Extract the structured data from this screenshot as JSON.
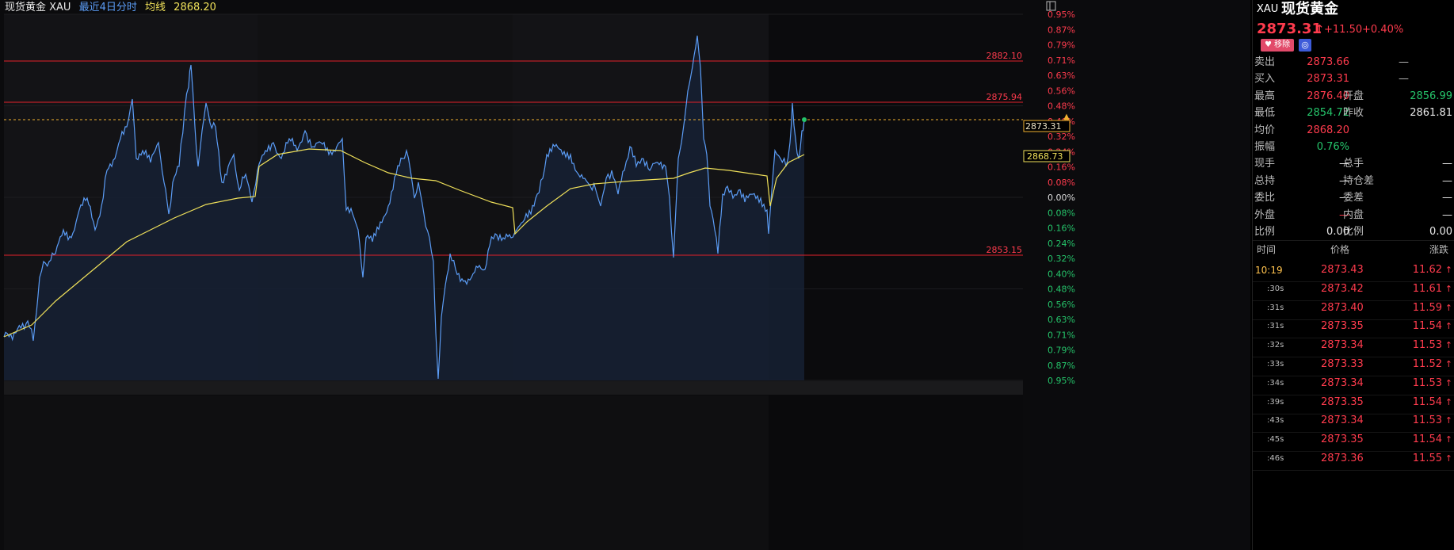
{
  "header": {
    "name": "现货黄金 XAU",
    "period": "最近4日分时",
    "avg_label": "均线",
    "avg_value": "2868.20"
  },
  "axis": {
    "left_labels": [
      "0.95%",
      "0.87%",
      "0.79%",
      "0.71%",
      "0.63%",
      "0.56%",
      "0.48%",
      "0.40%",
      "0.32%",
      "0.24%",
      "0.16%",
      "0.08%",
      "0.00%",
      "0.08%",
      "0.16%",
      "0.24%",
      "0.32%",
      "0.40%",
      "0.48%",
      "0.56%",
      "0.63%",
      "0.71%",
      "0.79%",
      "0.87%",
      "0.95%"
    ],
    "price_lines": [
      "2882.10",
      "2875.94",
      "2853.15"
    ],
    "current_price_tag": "2873.31",
    "avg_price_tag": "2868.73"
  },
  "quote": {
    "code": "XAU",
    "name": "现货黄金",
    "price": "2873.31",
    "arrow": "↑",
    "change": "+11.50",
    "change_pct": "+0.40%",
    "unfollow_label": "移除"
  },
  "stats": [
    {
      "k1": "卖出",
      "v1": "2873.66",
      "c1": "red",
      "k2": "—",
      "v2": "",
      "c2": "white"
    },
    {
      "k1": "买入",
      "v1": "2873.31",
      "c1": "red",
      "k2": "—",
      "v2": "",
      "c2": "white"
    },
    {
      "k1": "最高",
      "v1": "2876.40",
      "c1": "red",
      "k2": "开盘",
      "v2": "2856.99",
      "c2": "green"
    },
    {
      "k1": "最低",
      "v1": "2854.72",
      "c1": "green",
      "k2": "昨收",
      "v2": "2861.81",
      "c2": "white"
    },
    {
      "k1": "均价",
      "v1": "2868.20",
      "c1": "red",
      "k2": "",
      "v2": "",
      "c2": "white"
    },
    {
      "k1": "振幅",
      "v1": "0.76%",
      "c1": "green",
      "k2": "",
      "v2": "",
      "c2": "white"
    },
    {
      "k1": "现手",
      "v1": "—",
      "c1": "white",
      "k2": "总手",
      "v2": "—",
      "c2": "white"
    },
    {
      "k1": "总持",
      "v1": "—",
      "c1": "white",
      "k2": "持仓差",
      "v2": "—",
      "c2": "white"
    },
    {
      "k1": "委比",
      "v1": "—",
      "c1": "white",
      "k2": "委差",
      "v2": "—",
      "c2": "white"
    },
    {
      "k1": "外盘",
      "v1": "—",
      "c1": "red",
      "k2": "内盘",
      "v2": "—",
      "c2": "white"
    },
    {
      "k1": "比例",
      "v1": "0.00",
      "c1": "white",
      "k2": "比例",
      "v2": "0.00",
      "c2": "white"
    }
  ],
  "ticks_header": {
    "time": "时间",
    "price": "价格",
    "change": "涨跌"
  },
  "ticks": [
    {
      "time": "10:19",
      "price": "2873.43",
      "change": "11.62"
    },
    {
      "time": ":30s",
      "price": "2873.42",
      "change": "11.61"
    },
    {
      "time": ":31s",
      "price": "2873.40",
      "change": "11.59"
    },
    {
      "time": ":31s",
      "price": "2873.35",
      "change": "11.54"
    },
    {
      "time": ":32s",
      "price": "2873.34",
      "change": "11.53"
    },
    {
      "time": ":33s",
      "price": "2873.33",
      "change": "11.52"
    },
    {
      "time": ":34s",
      "price": "2873.34",
      "change": "11.53"
    },
    {
      "time": ":39s",
      "price": "2873.35",
      "change": "11.54"
    },
    {
      "time": ":43s",
      "price": "2873.34",
      "change": "11.53"
    },
    {
      "time": ":45s",
      "price": "2873.35",
      "change": "11.54"
    },
    {
      "time": ":46s",
      "price": "2873.36",
      "change": "11.55"
    }
  ],
  "colors": {
    "price_line": "#5b9cf5",
    "avg_line": "#f0e15a",
    "ref_line": "#e0202a",
    "up": "#ff3b4d",
    "down": "#25c46a"
  }
}
